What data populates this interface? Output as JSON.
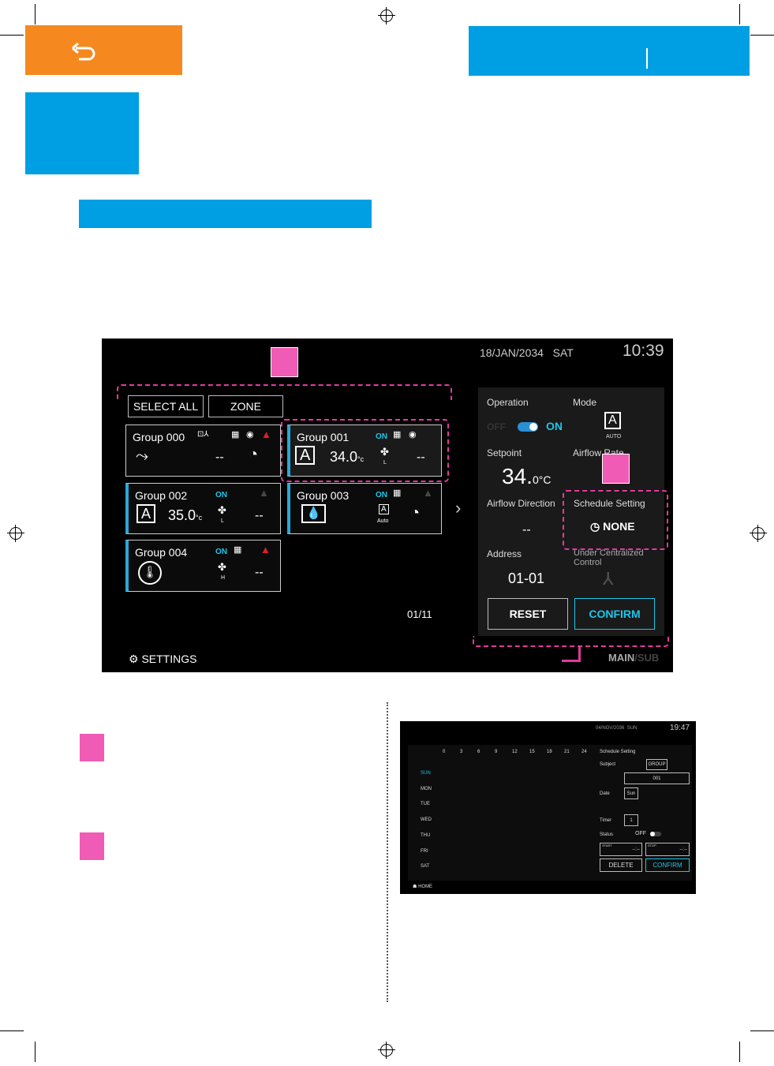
{
  "page": {
    "colors": {
      "orange": "#f5891f",
      "blue": "#009fe3",
      "marker_pink": "#f05bb5",
      "accent_cyan": "#1ec6e8"
    },
    "back_icon": "undo-arrow-icon"
  },
  "screen": {
    "date": "18/JAN/2034",
    "day": "SAT",
    "time": "10:39",
    "select_all": "SELECT ALL",
    "zone": "ZONE",
    "groups": [
      {
        "name": "Group 000",
        "status": "",
        "setpoint": "",
        "value": "--",
        "fan": ""
      },
      {
        "name": "Group 001",
        "status": "ON",
        "setpoint": "34.0",
        "unit": "°c",
        "value": "--",
        "fan": "L"
      },
      {
        "name": "Group 002",
        "status": "ON",
        "setpoint": "35.0",
        "unit": "°c",
        "value": "--",
        "fan": "L"
      },
      {
        "name": "Group 003",
        "status": "ON",
        "setpoint": "",
        "value": "",
        "fan": "Auto"
      },
      {
        "name": "Group 004",
        "status": "ON",
        "setpoint": "",
        "value": "--",
        "fan": "H"
      }
    ],
    "page_indicator": "01/11",
    "settings": "SETTINGS",
    "panel": {
      "operation_label": "Operation",
      "off": "OFF",
      "on": "ON",
      "operation_on": true,
      "mode_label": "Mode",
      "mode": "AUTO",
      "setpoint_label": "Setpoint",
      "setpoint": "34.",
      "setpoint_dec": "0°C",
      "airflow_rate_label": "Airflow Rate",
      "airflow_direction_label": "Airflow Direction",
      "airflow_direction": "--",
      "schedule_label": "Schedule Setting",
      "schedule": "NONE",
      "address_label": "Address",
      "address": "01-01",
      "centralized_label": "Under Centralized Control",
      "reset": "RESET",
      "confirm": "CONFIRM"
    },
    "main": "MAIN",
    "sub": "/SUB"
  },
  "mini": {
    "date": "04/NOV/2036",
    "day": "SUN",
    "time": "19:47",
    "hours": [
      "0",
      "3",
      "6",
      "9",
      "12",
      "15",
      "18",
      "21",
      "24"
    ],
    "days": [
      "SUN",
      "MON",
      "TUE",
      "WED",
      "THU",
      "FRI",
      "SAT"
    ],
    "title": "Schedule Setting",
    "subject_label": "Subject",
    "subject": "GROUP",
    "group_no": "001",
    "date_label": "Date",
    "date_value": "Sun",
    "timer_label": "Timer",
    "timer": "1",
    "status_label": "Status",
    "status": "OFF",
    "start": "START",
    "stop": "STOP",
    "time_blank": "--:--",
    "delete": "DELETE",
    "confirm": "CONFIRM",
    "home": "HOME"
  }
}
